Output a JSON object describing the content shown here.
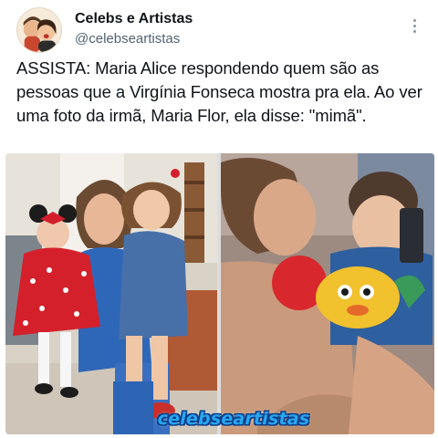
{
  "account": {
    "display_name": "Celebs e Artistas",
    "handle": "@celebseartistas",
    "avatar_icon": "cartoon-couple-avatar"
  },
  "menu": {
    "icon": "more-vertical-icon"
  },
  "tweet": {
    "text": "ASSISTA: Maria Alice respondendo quem são as pessoas que a Virgínia Fonseca mostra pra ela. Ao ver uma foto da irmã, Maria Flor, ela disse: \"mimã\"."
  },
  "media": {
    "watermark": "celebseartistas",
    "watermark_color": "#2aa6f0"
  },
  "colors": {
    "text": "#0f1419",
    "secondary": "#536471"
  }
}
